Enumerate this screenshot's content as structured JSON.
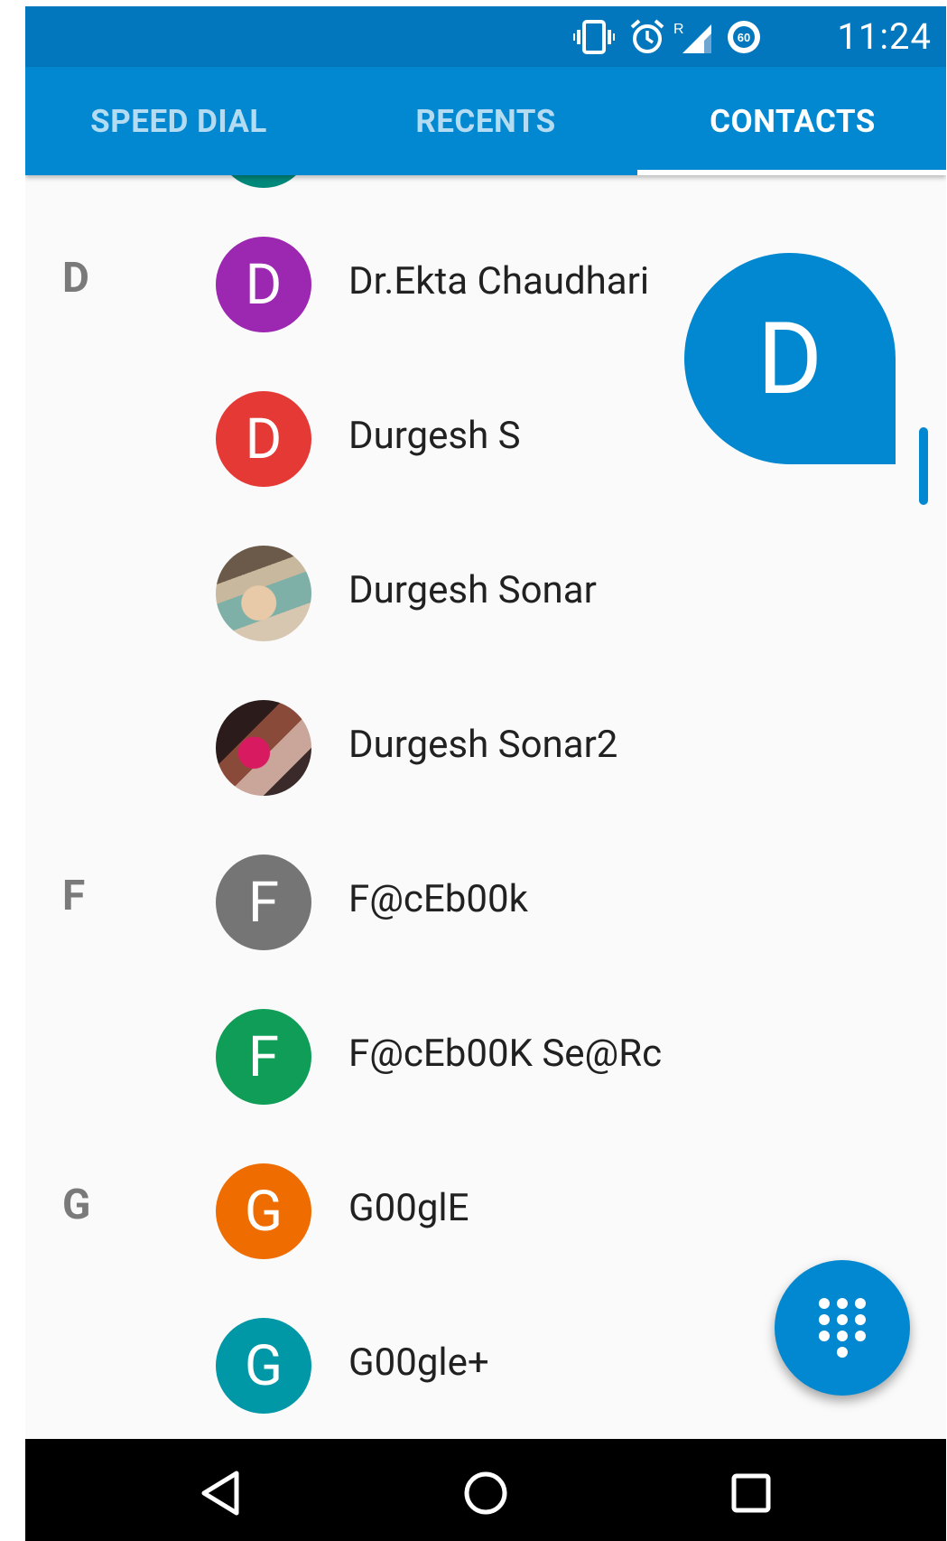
{
  "status_bar": {
    "time": "11:24",
    "icons": [
      "vibrate-icon",
      "alarm-icon",
      "roaming-signal-icon",
      "battery-saver-60-icon"
    ],
    "roaming_label": "R",
    "data_saver_label": "60"
  },
  "tabs": [
    {
      "label": "SPEED DIAL",
      "active": false
    },
    {
      "label": "RECENTS",
      "active": false
    },
    {
      "label": "CONTACTS",
      "active": true
    }
  ],
  "fast_scroll_letter": "D",
  "contacts": [
    {
      "section": "D",
      "name": "Dr.Ekta Chaudhari",
      "initial": "D",
      "avatar_color": "#9c27b0",
      "photo": false
    },
    {
      "section": "",
      "name": "Durgesh S",
      "initial": "D",
      "avatar_color": "#e53935",
      "photo": false
    },
    {
      "section": "",
      "name": "Durgesh Sonar",
      "initial": "",
      "avatar_color": "#8fa88a",
      "photo": true
    },
    {
      "section": "",
      "name": "Durgesh Sonar2",
      "initial": "",
      "avatar_color": "#5a2a2a",
      "photo": true
    },
    {
      "section": "F",
      "name": "F@cEb00k",
      "initial": "F",
      "avatar_color": "#757575",
      "photo": false
    },
    {
      "section": "",
      "name": "F@cEb00K Se@Rc",
      "initial": "F",
      "avatar_color": "#0f9d58",
      "photo": false
    },
    {
      "section": "G",
      "name": "G00glE",
      "initial": "G",
      "avatar_color": "#ef6c00",
      "photo": false
    },
    {
      "section": "",
      "name": "G00gle+",
      "initial": "G",
      "avatar_color": "#0097a7",
      "photo": false
    }
  ],
  "fab": {
    "icon": "dialpad-icon"
  },
  "nav": {
    "icons": [
      "back-icon",
      "home-icon",
      "recents-icon"
    ]
  },
  "colors": {
    "primary": "#0288d1",
    "primary_dark": "#0277bd"
  }
}
